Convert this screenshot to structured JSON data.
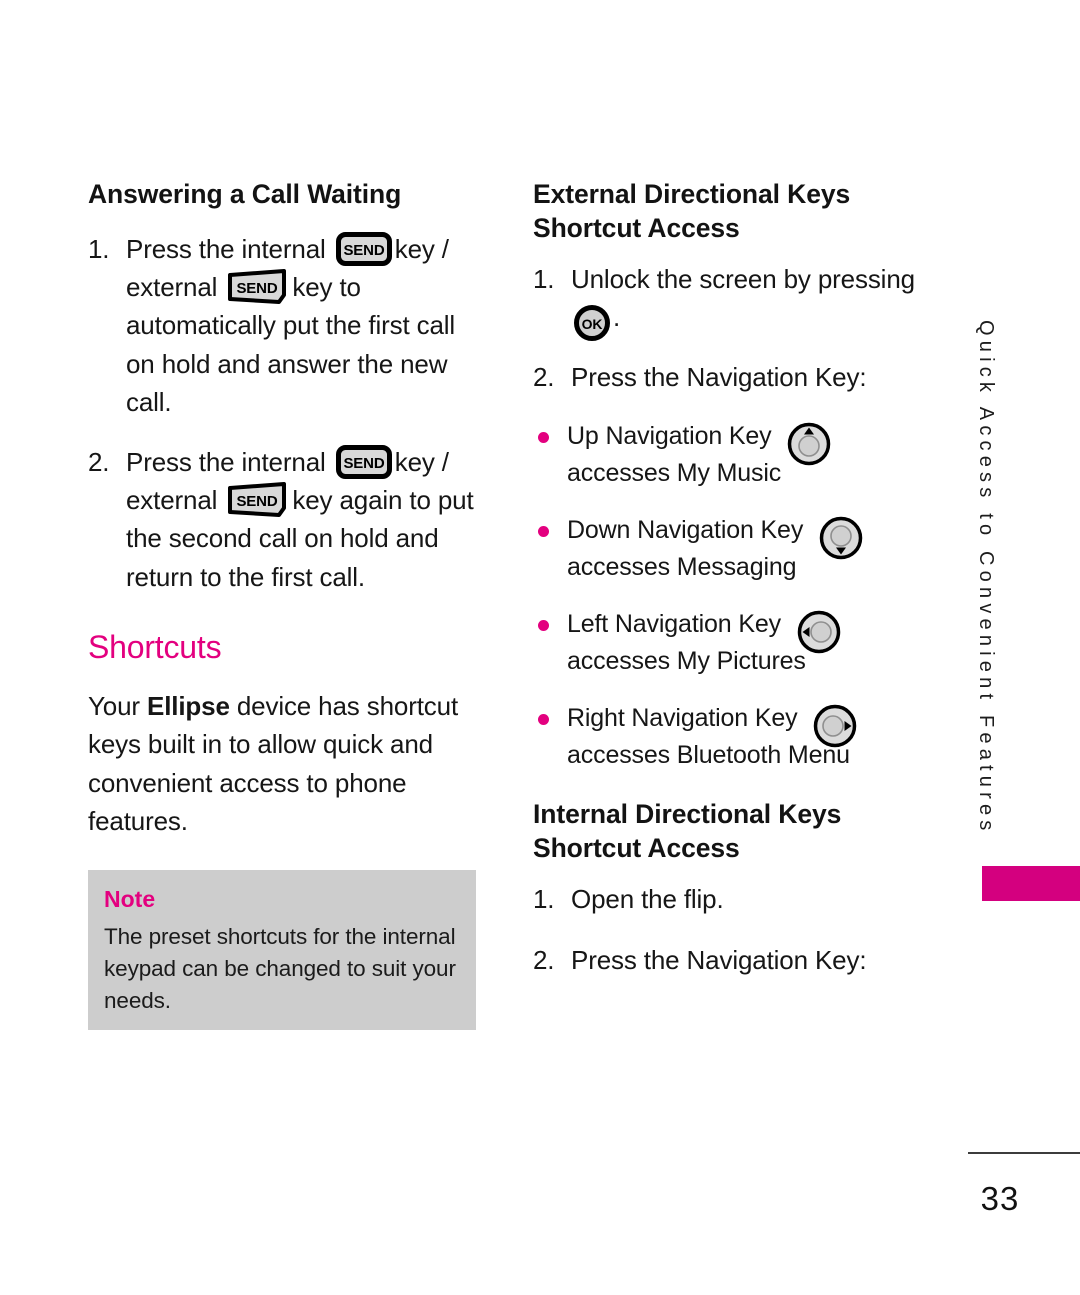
{
  "page": {
    "number": "33",
    "side_tab_label": "Quick Access to Convenient Features",
    "accent_color": "#e3007f",
    "tab_color": "#d4007f",
    "note_bg_color": "#cdcdcd"
  },
  "left_column": {
    "heading": "Answering a Call Waiting",
    "steps": [
      {
        "number": "1.",
        "part1": "Press the internal",
        "icon1": "send-key-internal-icon",
        "part2": "key / external",
        "icon2": "send-key-external-icon",
        "part3": "key to automatically put the first call on hold and answer the new call."
      },
      {
        "number": "2.",
        "part1": "Press the internal",
        "icon1": "send-key-internal-icon",
        "part2": "key / external",
        "icon2": "send-key-external-icon",
        "part3": "key again to put the second call on hold and return to the first call."
      }
    ],
    "shortcuts_heading": "Shortcuts",
    "shortcuts_paragraph_pre": "Your ",
    "shortcuts_paragraph_bold": "Ellipse",
    "shortcuts_paragraph_post": " device has shortcut keys built in to allow quick and convenient access to phone features.",
    "note": {
      "title": "Note",
      "body": "The preset shortcuts for the internal keypad can be changed to suit your needs."
    }
  },
  "right_column": {
    "external_heading": "External Directional Keys Shortcut Access",
    "external_steps": [
      {
        "number": "1.",
        "part1": "Unlock the screen by pressing",
        "icon1": "ok-key-icon",
        "part2": "."
      },
      {
        "number": "2.",
        "part1": "Press the Navigation Key:",
        "icon1": "",
        "part2": ""
      }
    ],
    "nav_bullets": [
      {
        "label": "Up Navigation Key",
        "icon": "nav-key-up-icon",
        "detail": "accesses My Music"
      },
      {
        "label": "Down Navigation Key",
        "icon": "nav-key-down-icon",
        "detail": "accesses Messaging"
      },
      {
        "label": "Left Navigation Key",
        "icon": "nav-key-left-icon",
        "detail": "accesses My Pictures"
      },
      {
        "label": "Right Navigation Key",
        "icon": "nav-key-right-icon",
        "detail": "accesses Bluetooth Menu"
      }
    ],
    "internal_heading": "Internal Directional Keys Shortcut Access",
    "internal_steps": [
      {
        "number": "1.",
        "text": "Open the flip."
      },
      {
        "number": "2.",
        "text": "Press the Navigation Key:"
      }
    ]
  },
  "icon_labels": {
    "send": "SEND",
    "ok": "OK"
  }
}
